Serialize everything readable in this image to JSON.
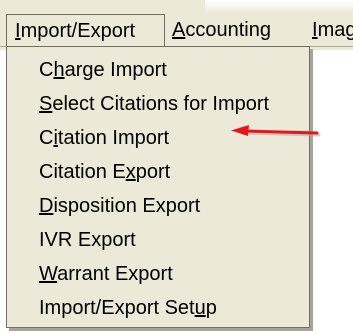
{
  "menubar": {
    "items": [
      {
        "label": "Import/Export",
        "pre": "",
        "key": "I",
        "post": "mport/Export"
      },
      {
        "label": "Accounting",
        "pre": "",
        "key": "A",
        "post": "ccounting"
      },
      {
        "label": "Imaging",
        "pre": "",
        "key": "I",
        "post": "mag"
      }
    ]
  },
  "dropdown": {
    "items": [
      {
        "label": "Charge Import",
        "pre": "C",
        "key": "h",
        "post": "arge Import"
      },
      {
        "label": "Select Citations for Import",
        "pre": "",
        "key": "S",
        "post": "elect Citations for Import"
      },
      {
        "label": "Citation Import",
        "pre": "C",
        "key": "i",
        "post": "tation Import"
      },
      {
        "label": "Citation Export",
        "pre": "Citation E",
        "key": "x",
        "post": "port"
      },
      {
        "label": "Disposition Export",
        "pre": "",
        "key": "D",
        "post": "isposition Export"
      },
      {
        "label": "IVR Export",
        "pre": "IVR Export",
        "key": "",
        "post": ""
      },
      {
        "label": "Warrant Export",
        "pre": "",
        "key": "W",
        "post": "arrant Export"
      },
      {
        "label": "Import/Export Setup",
        "pre": "Import/Export Set",
        "key": "u",
        "post": "p"
      }
    ]
  },
  "annotation": {
    "arrow_color": "#e8141c"
  }
}
